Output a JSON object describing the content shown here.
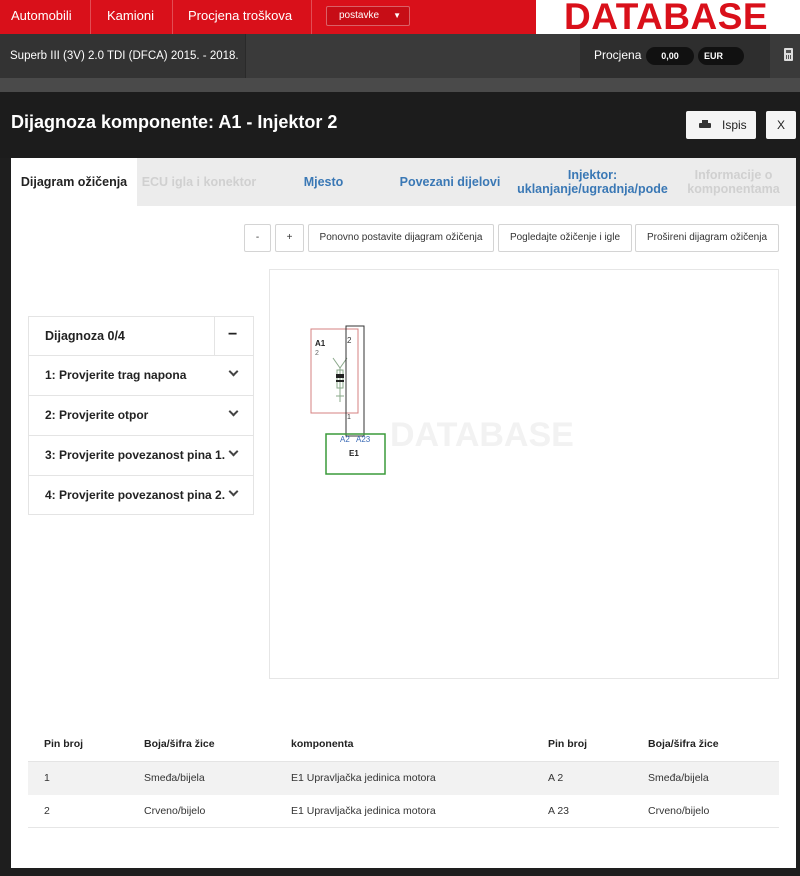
{
  "topnav": {
    "items": [
      "Automobili",
      "Kamioni",
      "Procjena troškova"
    ],
    "settings_label": "postavke",
    "logo_text": "DATABASE",
    "accent_color": "#d9101a"
  },
  "vehicle": {
    "description": "Superb III (3V) 2.0 TDI (DFCA) 2015. - 2018.",
    "estimate_label": "Procjena",
    "estimate_value": "0,00",
    "currency": "EUR"
  },
  "modal": {
    "title": "Dijagnoza komponente: A1 - Injektor 2",
    "print_label": "Ispis",
    "close_label": "X"
  },
  "tabs": [
    {
      "label": "Dijagram ožičenja",
      "state": "active"
    },
    {
      "label": "ECU igla i konektor",
      "state": "disabled"
    },
    {
      "label": "Mjesto",
      "state": "link"
    },
    {
      "label": "Povezani dijelovi",
      "state": "link"
    },
    {
      "label": "Injektor: uklanjanje/ugradnja/pode",
      "state": "link"
    },
    {
      "label": "Informacije o komponentama",
      "state": "disabled"
    }
  ],
  "toolbar": {
    "zoom_out": "-",
    "zoom_in": "+",
    "reset": "Ponovno postavite dijagram ožičenja",
    "view_wiring": "Pogledajte ožičenje i igle",
    "expand": "Prošireni dijagram ožičenja"
  },
  "diagnosis": {
    "title": "Dijagnoza 0/4",
    "collapse_symbol": "−",
    "steps": [
      "1: Provjerite trag napona",
      "2: Provjerite otpor",
      "3: Provjerite povezanost pina 1.",
      "4: Provjerite povezanost pina 2."
    ]
  },
  "diagram": {
    "component_a1": {
      "label": "A1",
      "sub": "2",
      "pin_top": "2",
      "pin_bottom": "1"
    },
    "component_e1": {
      "label": "E1",
      "pin_left": "A2",
      "pin_right": "A23"
    }
  },
  "pin_table": {
    "headers": [
      "Pin broj",
      "Boja/šifra žice",
      "komponenta",
      "Pin broj",
      "Boja/šifra žice"
    ],
    "rows": [
      [
        "1",
        "Smeđa/bijela",
        "E1 Upravljačka jedinica motora",
        "A 2",
        "Smeđa/bijela"
      ],
      [
        "2",
        "Crveno/bijelo",
        "E1 Upravljačka jedinica motora",
        "A 23",
        "Crveno/bijelo"
      ]
    ]
  }
}
